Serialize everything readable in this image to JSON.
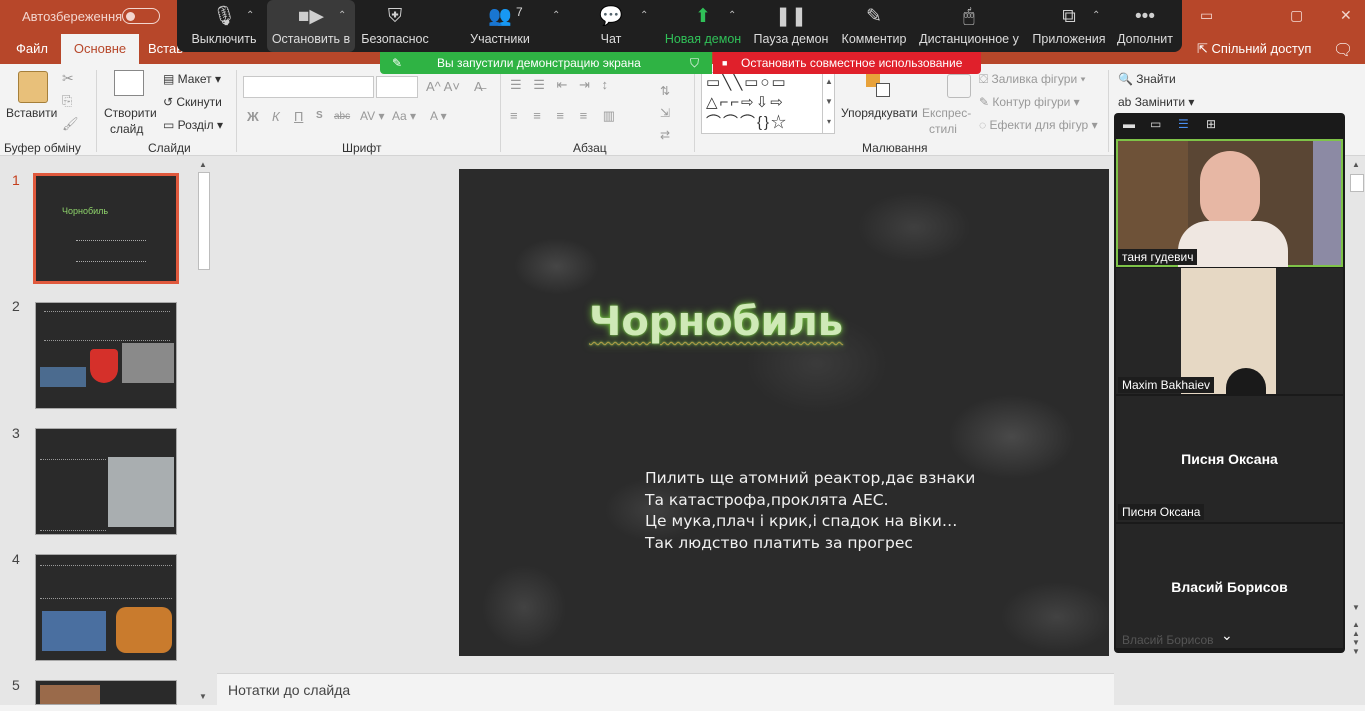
{
  "titlebar": {
    "autosave_label": "Автозбереження",
    "share_label": "Спільний доступ",
    "tabs": [
      "Файл",
      "Основне",
      "Встав"
    ]
  },
  "ribbon": {
    "paste": "Вставити",
    "new_slide_1": "Створити",
    "new_slide_2": "слайд",
    "layout": "Макет",
    "reset": "Скинути",
    "section": "Розділ",
    "bold": "Ж",
    "italic": "К",
    "underline": "П",
    "strike": "abc",
    "find": "Знайти",
    "replace": "Замінити",
    "arrange": "Упорядкувати",
    "quick_styles_1": "Експрес-",
    "quick_styles_2": "стилі",
    "shape_fill": "Заливка фігури",
    "shape_outline": "Контур фігури",
    "shape_effects": "Ефекти для фігур",
    "groups": {
      "clipboard": "Буфер обміну",
      "slides": "Слайди",
      "font": "Шрифт",
      "paragraph": "Абзац",
      "drawing": "Малювання"
    }
  },
  "zoom_toolbar": {
    "mute": "Выключить",
    "stop_video": "Остановить в",
    "security": "Безопаснос",
    "participants": "Участники",
    "participants_count": "7",
    "chat": "Чат",
    "new_share": "Новая демон",
    "pause_share": "Пауза демон",
    "annotate": "Комментир",
    "remote_control": "Дистанционное у",
    "apps": "Приложения",
    "more": "Дополнит",
    "banner_sharing": "Вы запустили демонстрацию экрана",
    "banner_stop": "Остановить совместное использование"
  },
  "slides": [
    {
      "num": "1",
      "title": "Чорнобиль",
      "selected": true
    },
    {
      "num": "2"
    },
    {
      "num": "3"
    },
    {
      "num": "4"
    },
    {
      "num": "5"
    }
  ],
  "current_slide": {
    "title": "Чорнобиль",
    "lines": [
      "Пилить ще атомний реактор,дає взнаки",
      "Та катастрофа,проклята АЕС.",
      "Це мука,плач і крик,і спадок на віки…",
      "Так людство платить за прогрес"
    ]
  },
  "notes_placeholder": "Нотатки до слайда",
  "gallery": {
    "participants": [
      {
        "name": "таня гудевич",
        "video": true
      },
      {
        "name": "Maxim Bakhaiev",
        "video": true
      },
      {
        "name": "Писня Оксана",
        "video": false
      },
      {
        "name": "Власий Борисов",
        "video": false
      }
    ]
  },
  "colors": {
    "ppt_accent": "#b7472a",
    "zoom_green": "#2fb344",
    "zoom_red": "#e0202b"
  }
}
